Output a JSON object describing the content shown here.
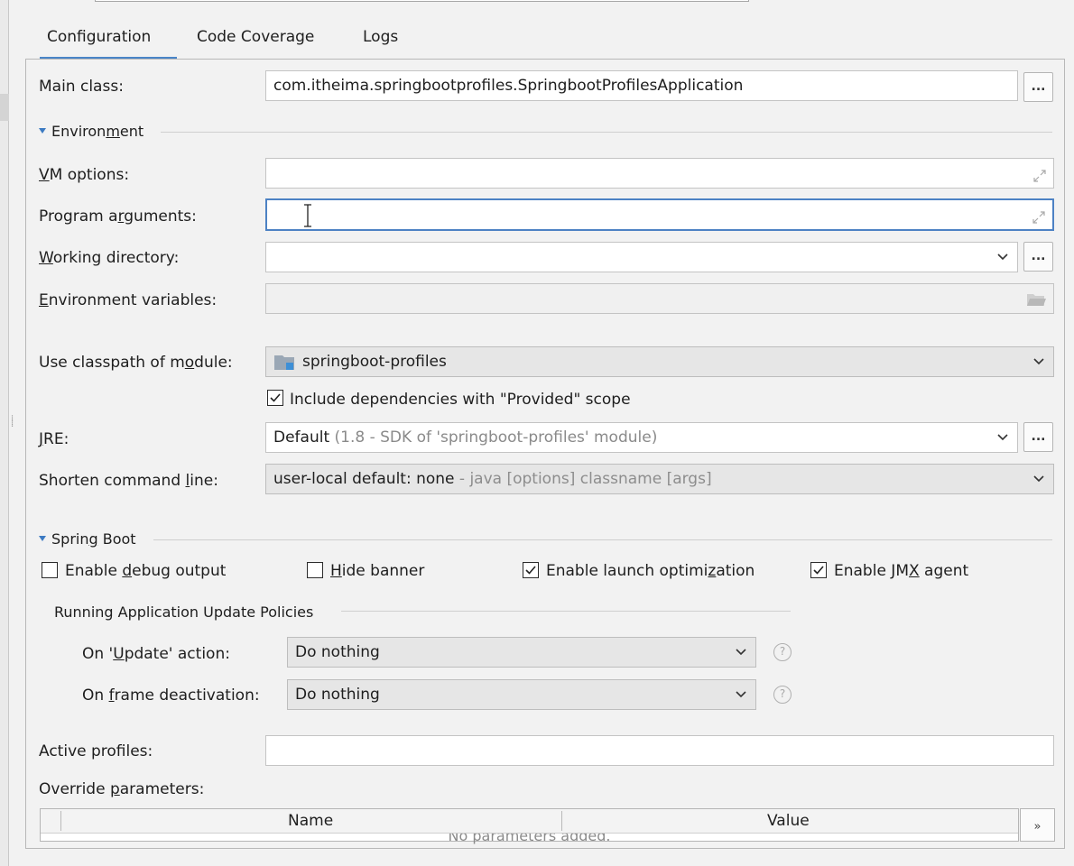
{
  "tabs": [
    {
      "label": "Configuration",
      "active": true
    },
    {
      "label": "Code Coverage",
      "active": false
    },
    {
      "label": "Logs",
      "active": false
    }
  ],
  "main_class": {
    "label": "Main class:",
    "value": "com.itheima.springbootprofiles.SpringbootProfilesApplication",
    "browse": "..."
  },
  "environment": {
    "header": {
      "pre": "Environ",
      "mn": "m",
      "post": "ent"
    },
    "vm_options": {
      "mn": "V",
      "rest": "M options:",
      "value": ""
    },
    "program_arguments": {
      "pre": "Program a",
      "mn": "r",
      "post": "guments:",
      "value": ""
    },
    "working_directory": {
      "mn": "W",
      "rest": "orking directory:",
      "value": "",
      "browse": "..."
    },
    "environment_variables": {
      "mn": "E",
      "rest": "nvironment variables:",
      "value": ""
    }
  },
  "classpath": {
    "pre": "Use classpath of m",
    "mn": "o",
    "post": "dule:",
    "value": "springboot-profiles"
  },
  "include_dependencies": {
    "label": "Include dependencies with \"Provided\" scope",
    "checked": true
  },
  "jre": {
    "mn": "J",
    "rest": "RE:",
    "value_main": "Default",
    "value_detail": "(1.8 - SDK of 'springboot-profiles' module)",
    "browse": "..."
  },
  "shorten_command_line": {
    "pre": "Shorten command ",
    "mn": "l",
    "post": "ine:",
    "value_main": "user-local default: none",
    "value_detail": "- java [options] classname [args]"
  },
  "spring_boot": {
    "header": {
      "pre": "Sprin",
      "mn": "g",
      "post": " Boot"
    },
    "options": [
      {
        "pre": "Enable ",
        "mn": "d",
        "post": "ebug output",
        "checked": false
      },
      {
        "pre": "",
        "mn": "H",
        "post": "ide banner",
        "checked": false
      },
      {
        "pre": "Enable launch optimi",
        "mn": "z",
        "post": "ation",
        "checked": true
      },
      {
        "pre": "Enable JM",
        "mn": "X",
        "post": " agent",
        "checked": true
      }
    ],
    "update_policies": {
      "header": "Running Application Update Policies",
      "on_update": {
        "pre": "On '",
        "mn": "U",
        "post": "pdate' action:",
        "value": "Do nothing"
      },
      "on_frame_deactivation": {
        "pre": "On ",
        "mn": "f",
        "post": "rame deactivation:",
        "value": "Do nothing"
      },
      "help": "?"
    }
  },
  "active_profiles": {
    "label": "Active profiles:",
    "value": ""
  },
  "override_parameters": {
    "pre": "Override ",
    "mn": "p",
    "post": "arameters:",
    "columns": [
      "Name",
      "Value"
    ],
    "empty_text": "No parameters added.",
    "expand": "»"
  },
  "colors": {
    "accent": "#4a86c8",
    "focus": "#4d82c4",
    "panel_bg": "#f2f2f2"
  }
}
